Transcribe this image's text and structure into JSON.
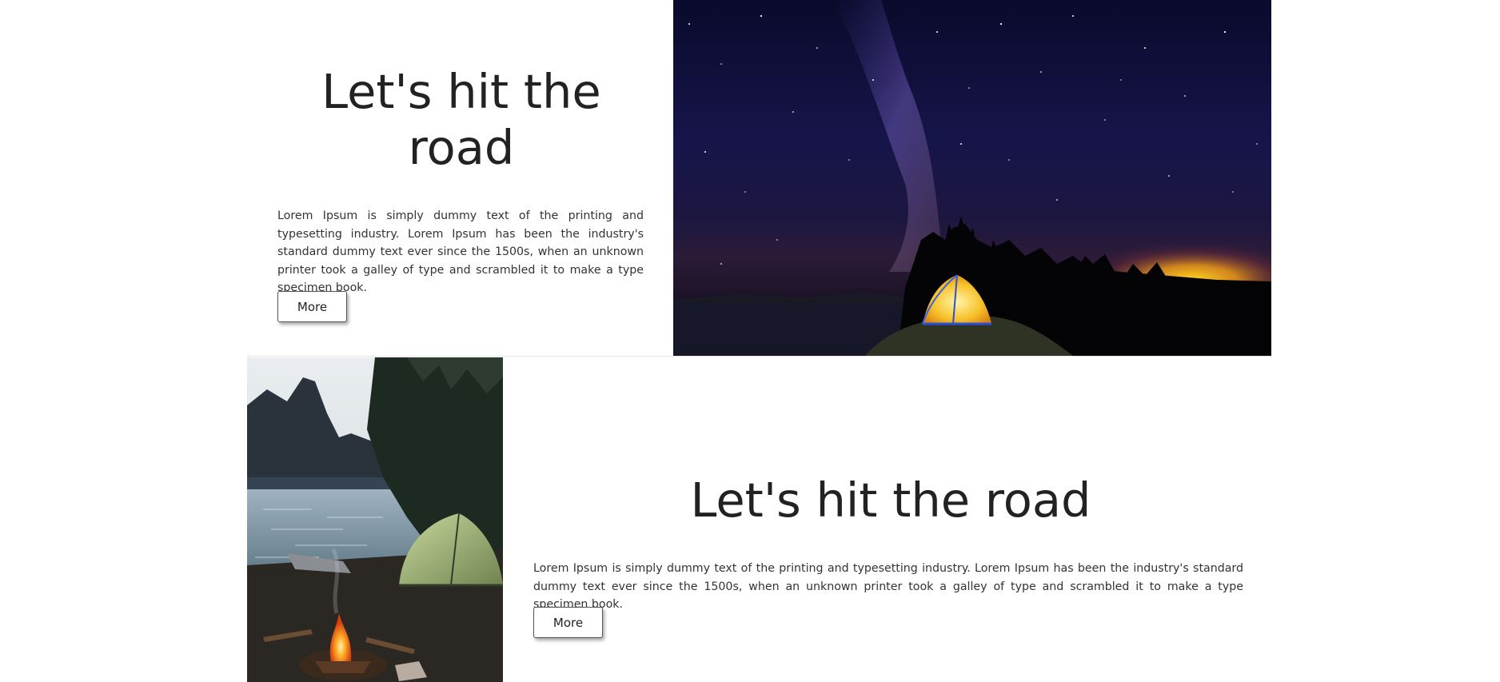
{
  "sections": [
    {
      "title": "Let's hit the road",
      "body": "Lorem Ipsum is simply dummy text of the printing and typesetting industry. Lorem Ipsum has been the industry's standard dummy text ever since the 1500s, when an unknown printer took a galley of type and scrambled it to make a type specimen book.",
      "button_label": "More"
    },
    {
      "title": "Let's hit the road",
      "body": "Lorem Ipsum is simply dummy text of the printing and typesetting industry. Lorem Ipsum has been the industry's standard dummy text ever since the 1500s, when an unknown printer took a galley of type and scrambled it to make a type specimen book.",
      "button_label": "More"
    }
  ],
  "colors": {
    "text": "#222222",
    "background": "#ffffff",
    "night_sky": "#151440",
    "sunset_glow": "#f5c21a",
    "tent_glow": "#f7d94c"
  },
  "images": [
    {
      "name": "night-sky-tent-photo"
    },
    {
      "name": "lakeside-campfire-tent-photo"
    }
  ]
}
